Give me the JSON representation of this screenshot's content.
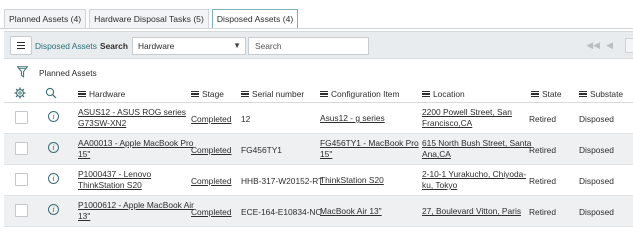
{
  "tabs": [
    {
      "label": "Planned Assets (4)",
      "active": false
    },
    {
      "label": "Hardware Disposal Tasks (5)",
      "active": false
    },
    {
      "label": "Disposed Assets (4)",
      "active": true
    }
  ],
  "toolbar": {
    "title": "Disposed Assets",
    "search_label": "Search",
    "search_field": "Hardware",
    "search_placeholder": "Search",
    "pager_first_icon": "double-chevron-left-icon",
    "pager_prev_icon": "chevron-left-icon"
  },
  "filter": {
    "text": "Planned Assets",
    "icon": "funnel-icon"
  },
  "columns": [
    {
      "key": "hardware",
      "label": "Hardware"
    },
    {
      "key": "stage",
      "label": "Stage"
    },
    {
      "key": "serial",
      "label": "Serial number"
    },
    {
      "key": "ci",
      "label": "Configuration Item"
    },
    {
      "key": "location",
      "label": "Location"
    },
    {
      "key": "state",
      "label": "State"
    },
    {
      "key": "substate",
      "label": "Substate"
    }
  ],
  "rows": [
    {
      "hardware": [
        "ASUS12 - ASUS ROG series",
        "G73SW-XN2"
      ],
      "stage": "Completed",
      "serial": "12",
      "ci": [
        "Asus12 - g series"
      ],
      "location": [
        "2200 Powell Street, San",
        "Francisco,CA"
      ],
      "state": "Retired",
      "substate": "Disposed"
    },
    {
      "hardware": [
        "AA00013 - Apple MacBook Pro",
        "15\""
      ],
      "stage": "Completed",
      "serial": "FG456TY1",
      "ci": [
        "FG456TY1 - MacBook Pro",
        "15\""
      ],
      "location": [
        "615 North Bush Street, Santa",
        "Ana,CA"
      ],
      "state": "Retired",
      "substate": "Disposed"
    },
    {
      "hardware": [
        "P1000437 - Lenovo",
        "ThinkStation S20"
      ],
      "stage": "Completed",
      "serial": "HHB-317-W20152-RT",
      "ci": [
        "ThinkStation S20"
      ],
      "location": [
        "2-10-1 Yurakucho, Chiyoda-",
        "ku, Tokyo"
      ],
      "state": "Retired",
      "substate": "Disposed"
    },
    {
      "hardware": [
        "P1000612 - Apple MacBook Air",
        "13\""
      ],
      "stage": "Completed",
      "serial": "ECE-164-E10834-NO",
      "ci": [
        "MacBook Air 13\""
      ],
      "location": [
        "27, Boulevard Vitton, Paris"
      ],
      "state": "Retired",
      "substate": "Disposed"
    }
  ],
  "colors": {
    "accent": "#29707a",
    "toolbar_bg": "#e9ecee",
    "alt_row_bg": "#eef0f1"
  }
}
